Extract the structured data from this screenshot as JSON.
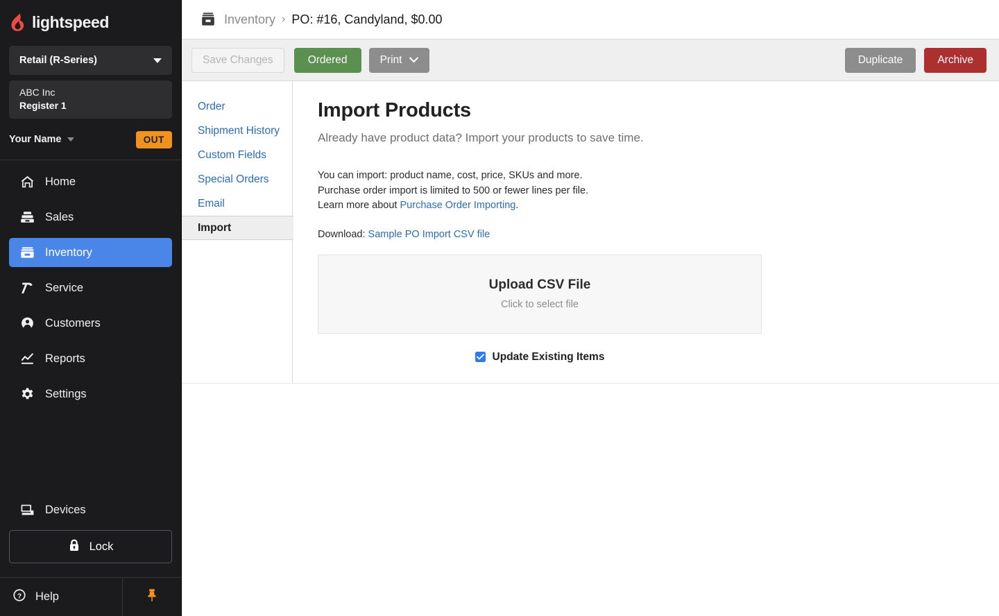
{
  "brand": {
    "name": "lightspeed",
    "flame_color": "#ef4b43",
    "accent_blue": "#4a86e8",
    "accent_orange": "#f0921e"
  },
  "sidebar": {
    "product_select": {
      "label": "Retail (R-Series)",
      "icon": "chevron-down-icon"
    },
    "account": {
      "company": "ABC Inc",
      "register": "Register 1"
    },
    "user": {
      "name": "Your Name",
      "status_badge": "OUT"
    },
    "nav_items": [
      {
        "label": "Home",
        "icon": "home-icon",
        "active": false
      },
      {
        "label": "Sales",
        "icon": "sales-register-icon",
        "active": false
      },
      {
        "label": "Inventory",
        "icon": "inventory-box-icon",
        "active": true
      },
      {
        "label": "Service",
        "icon": "hammer-icon",
        "active": false
      },
      {
        "label": "Customers",
        "icon": "person-icon",
        "active": false
      },
      {
        "label": "Reports",
        "icon": "chart-line-icon",
        "active": false
      },
      {
        "label": "Settings",
        "icon": "gear-icon",
        "active": false
      }
    ],
    "devices": {
      "label": "Devices",
      "icon": "monitor-icon"
    },
    "lock": {
      "label": "Lock",
      "icon": "lock-icon"
    },
    "help": {
      "label": "Help",
      "icon": "question-circle-icon"
    },
    "pin": {
      "icon": "pushpin-icon"
    }
  },
  "breadcrumb": {
    "icon": "inventory-box-icon",
    "root": "Inventory",
    "separator": "›",
    "current": "PO:  #16, Candyland, $0.00"
  },
  "toolbar": {
    "save_label": "Save Changes",
    "save_disabled": true,
    "ordered_label": "Ordered",
    "print_label": "Print",
    "print_caret": "⌄",
    "duplicate_label": "Duplicate",
    "archive_label": "Archive",
    "colors": {
      "ordered": "#5b9050",
      "print": "#8d8d8d",
      "duplicate": "#8d8d8d",
      "archive": "#ad3030"
    }
  },
  "subnav": {
    "items": [
      {
        "label": "Order",
        "active": false
      },
      {
        "label": "Shipment History",
        "active": false
      },
      {
        "label": "Custom Fields",
        "active": false
      },
      {
        "label": "Special Orders",
        "active": false
      },
      {
        "label": "Email",
        "active": false
      },
      {
        "label": "Import",
        "active": true
      }
    ]
  },
  "main": {
    "title": "Import Products",
    "subtitle": "Already have product data? Import your products to save time.",
    "info_line_1": "You can import: product name, cost, price, SKUs and more.",
    "info_line_2": "Purchase order import is limited to 500 or fewer lines per file.",
    "info_line_3_prefix": "Learn more about ",
    "info_line_3_link": "Purchase Order Importing",
    "info_line_3_suffix": ".",
    "download_prefix": "Download: ",
    "download_link": "Sample PO Import CSV file",
    "upload": {
      "title": "Upload CSV File",
      "hint": "Click to select file"
    },
    "checkbox": {
      "label": "Update Existing Items",
      "checked": true
    }
  }
}
